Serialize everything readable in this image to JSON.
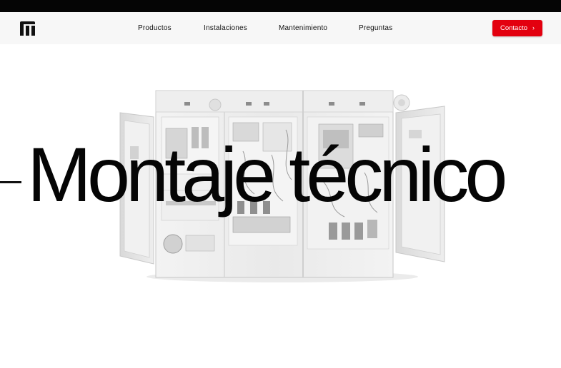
{
  "header": {
    "logo_icon": "brand-logo-icon"
  },
  "nav": {
    "items": [
      {
        "label": "Productos"
      },
      {
        "label": "Instalaciones"
      },
      {
        "label": "Mantenimiento"
      },
      {
        "label": "Preguntas"
      }
    ],
    "contact_label": "Contacto",
    "contact_icon": "chevron-right-icon",
    "accent_color": "#e3000f"
  },
  "hero": {
    "title": "Montaje técnico",
    "image_subject": "electrical-cabinet-image"
  }
}
